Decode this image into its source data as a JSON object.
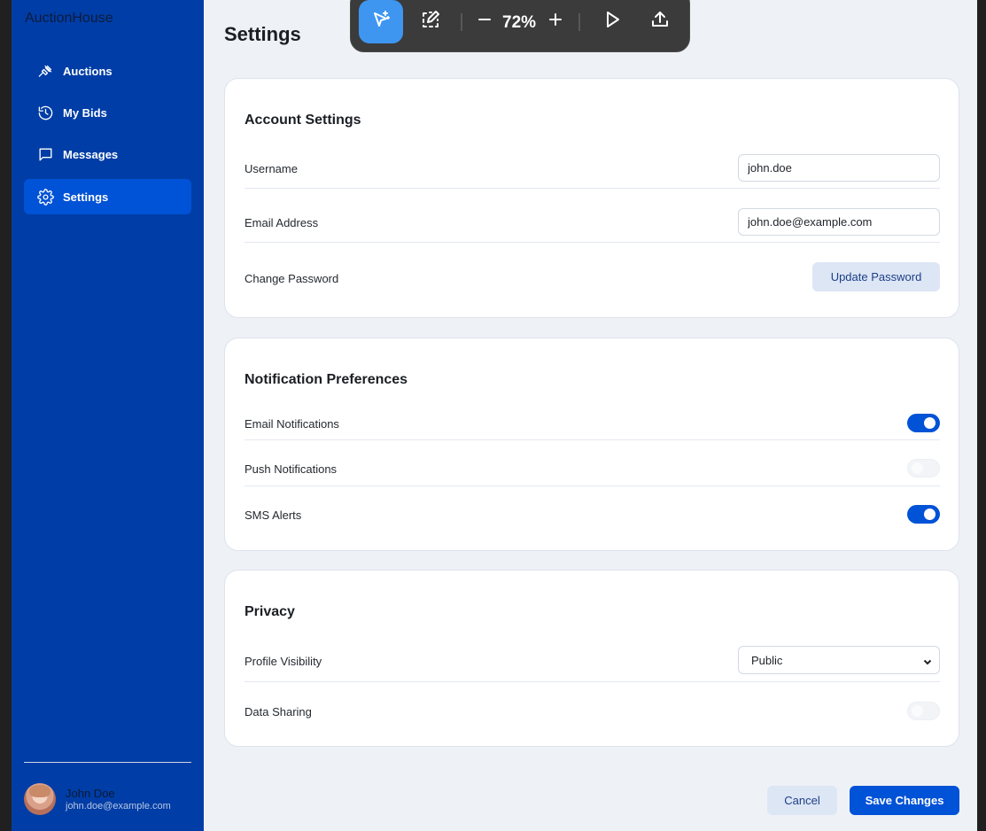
{
  "app": {
    "brand": "AuctionHouse"
  },
  "sidebar": {
    "items": [
      {
        "label": "Auctions",
        "icon": "gavel-icon",
        "active": false
      },
      {
        "label": "My Bids",
        "icon": "history-icon",
        "active": false
      },
      {
        "label": "Messages",
        "icon": "message-icon",
        "active": false
      },
      {
        "label": "Settings",
        "icon": "gear-icon",
        "active": true
      }
    ],
    "user": {
      "name": "John Doe",
      "email": "john.doe@example.com"
    }
  },
  "toolbar": {
    "zoom": "72%"
  },
  "page": {
    "title": "Settings"
  },
  "account": {
    "title": "Account Settings",
    "username_label": "Username",
    "username_value": "john.doe",
    "email_label": "Email Address",
    "email_value": "john.doe@example.com",
    "password_label": "Change Password",
    "password_button": "Update Password"
  },
  "notifications": {
    "title": "Notification Preferences",
    "email_label": "Email Notifications",
    "email_on": true,
    "push_label": "Push Notifications",
    "push_on": false,
    "sms_label": "SMS Alerts",
    "sms_on": true
  },
  "privacy": {
    "title": "Privacy",
    "visibility_label": "Profile Visibility",
    "visibility_value": "Public",
    "sharing_label": "Data Sharing",
    "sharing_on": false
  },
  "actions": {
    "cancel": "Cancel",
    "save": "Save Changes"
  },
  "colors": {
    "sidebar": "#003da6",
    "accent": "#0052d6",
    "background": "#eef2f7"
  }
}
